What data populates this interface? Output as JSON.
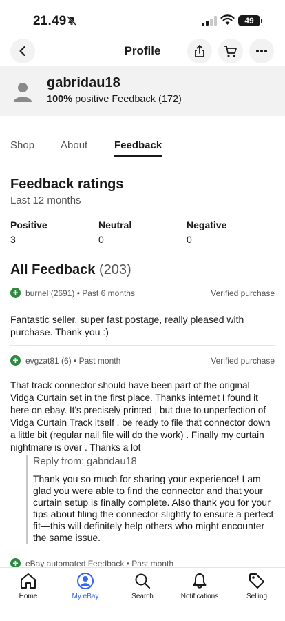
{
  "status_bar": {
    "time": "21.49",
    "battery": "49"
  },
  "nav": {
    "title": "Profile"
  },
  "profile": {
    "username": "gabridau18",
    "positive_percent": "100%",
    "positive_label": "positive Feedback (172)"
  },
  "tabs": [
    {
      "label": "Shop"
    },
    {
      "label": "About"
    },
    {
      "label": "Feedback"
    }
  ],
  "ratings": {
    "title": "Feedback ratings",
    "subtitle": "Last 12 months",
    "positive_label": "Positive",
    "positive_value": "3",
    "neutral_label": "Neutral",
    "neutral_value": "0",
    "negative_label": "Negative",
    "negative_value": "0"
  },
  "all_feedback": {
    "title": "All Feedback",
    "count": "(203)"
  },
  "feedback": [
    {
      "user": "burnel (2691) • Past 6 months",
      "badge": "Verified purchase",
      "text": "Fantastic seller, super fast postage, really pleased with purchase. Thank you :)"
    },
    {
      "user": "evgzat81 (6) • Past month",
      "badge": "Verified purchase",
      "text": "That track connector should have been part of the original Vidga Curtain set in the first place. Thanks internet I found it here on ebay. It's precisely printed , but due to unperfection of Vidga Curtain Track itself , be ready to file that connector down a little bit (regular nail file will do the work) . Finally my curtain nightmare is over . Thanks a lot",
      "reply_from": "Reply from: gabridau18",
      "reply_text": "Thank you so much for sharing your experience! I am glad you were able to find the connector and that your curtain setup is finally complete. Also thank you for your tips about filing the connector slightly to ensure a perfect fit—this will definitely help others who might encounter the same issue."
    },
    {
      "user": "eBay automated Feedback • Past month"
    }
  ],
  "bottom_nav": [
    {
      "label": "Home",
      "icon": "home-icon"
    },
    {
      "label": "My eBay",
      "icon": "user-circle-icon",
      "active": true
    },
    {
      "label": "Search",
      "icon": "search-icon"
    },
    {
      "label": "Notifications",
      "icon": "bell-icon"
    },
    {
      "label": "Selling",
      "icon": "tag-icon"
    }
  ],
  "colors": {
    "accent": "#3665f3",
    "positive": "#2a8a3e",
    "header_bg": "#f2f2f2"
  }
}
